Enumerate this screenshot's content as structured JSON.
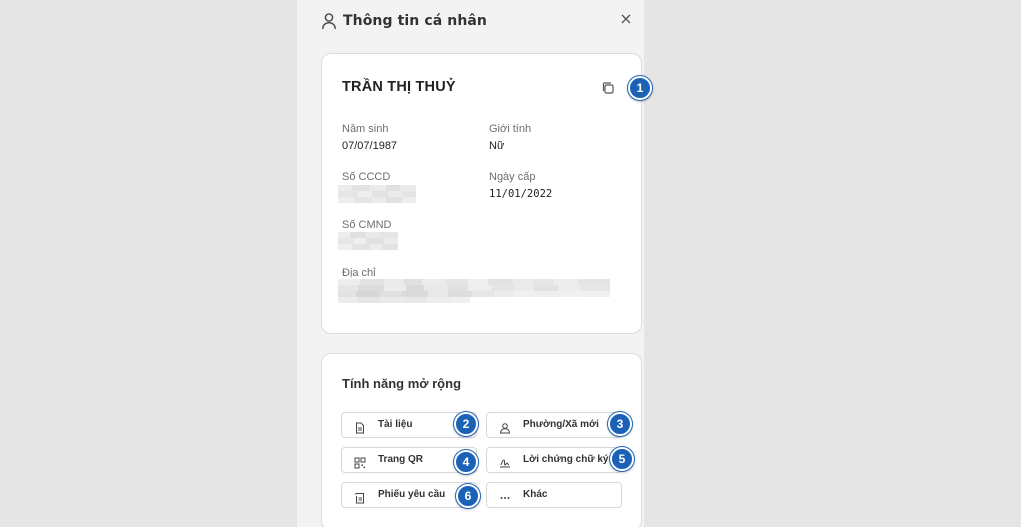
{
  "header": {
    "title": "Thông tin cá nhân",
    "close_symbol": "×",
    "user_icon": "user-icon",
    "close_icon": "close-icon"
  },
  "profile": {
    "name": "TRẦN THỊ THUỶ",
    "copy_icon": "copy-icon",
    "fields": {
      "birth_label": "Năm sinh",
      "birth_value": "07/07/1987",
      "gender_label": "Giới tính",
      "gender_value": "Nữ",
      "cccd_label": "Số CCCD",
      "issue_label": "Ngày cấp",
      "issue_value": "11/01/2022",
      "cmnd_label": "Số CMND",
      "address_label": "Địa chỉ"
    }
  },
  "extensions": {
    "title": "Tính năng mở rộng",
    "buttons": [
      {
        "label": "Tài liệu",
        "icon": "document-icon",
        "badge": "2"
      },
      {
        "label": "Phường/Xã mới",
        "icon": "person-location-icon",
        "badge": "3"
      },
      {
        "label": "Trang QR",
        "icon": "qr-code-icon",
        "badge": "4"
      },
      {
        "label": "Lời chứng chữ ký",
        "icon": "signature-icon",
        "badge": "5"
      },
      {
        "label": "Phiếu yêu cầu",
        "icon": "request-form-icon",
        "badge": "6"
      },
      {
        "label": "Khác",
        "icon": "more-icon",
        "badge": ""
      }
    ]
  },
  "callouts": {
    "copy_badge": "1"
  },
  "colors": {
    "badge_blue": "#1b62b7",
    "panel_bg": "#f3f3f4",
    "page_bg": "#e5e5e5"
  }
}
